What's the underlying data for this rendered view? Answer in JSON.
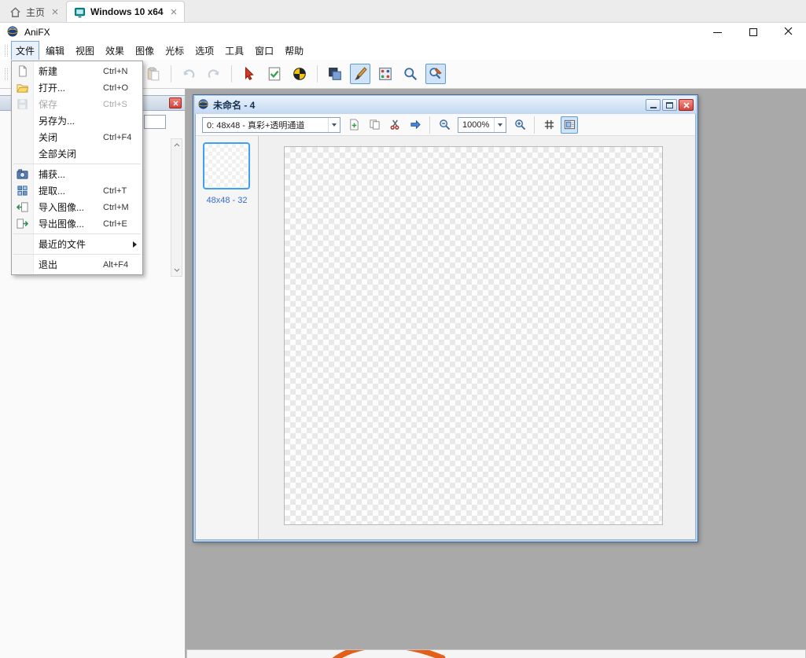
{
  "browser_tabs": {
    "tabs": [
      {
        "label": "主页",
        "icon": "home-icon",
        "active": false
      },
      {
        "label": "Windows 10 x64",
        "icon": "vm-icon",
        "active": true
      }
    ]
  },
  "window": {
    "title": "AniFX",
    "logo_icon": "app-logo-icon",
    "controls": [
      "minimize-icon",
      "maximize-icon",
      "close-icon"
    ]
  },
  "menubar": {
    "items": [
      {
        "label": "文件",
        "active": true
      },
      {
        "label": "编辑"
      },
      {
        "label": "视图"
      },
      {
        "label": "效果"
      },
      {
        "label": "图像"
      },
      {
        "label": "光标"
      },
      {
        "label": "选项"
      },
      {
        "label": "工具"
      },
      {
        "label": "窗口"
      },
      {
        "label": "帮助"
      }
    ]
  },
  "file_menu": {
    "items": [
      {
        "label": "新建",
        "shortcut": "Ctrl+N",
        "icon": "new-document-icon"
      },
      {
        "label": "打开...",
        "shortcut": "Ctrl+O",
        "icon": "open-folder-icon"
      },
      {
        "label": "保存",
        "shortcut": "Ctrl+S",
        "icon": "save-icon",
        "disabled": true
      },
      {
        "label": "另存为..."
      },
      {
        "label": "关闭",
        "shortcut": "Ctrl+F4"
      },
      {
        "label": "全部关闭"
      },
      {
        "separator": true
      },
      {
        "label": "捕获...",
        "icon": "capture-icon"
      },
      {
        "label": "提取...",
        "shortcut": "Ctrl+T",
        "icon": "extract-icon"
      },
      {
        "label": "导入图像...",
        "shortcut": "Ctrl+M",
        "icon": "import-image-icon"
      },
      {
        "label": "导出图像...",
        "shortcut": "Ctrl+E",
        "icon": "export-image-icon"
      },
      {
        "separator": true
      },
      {
        "label": "最近的文件",
        "submenu": true
      },
      {
        "separator": true
      },
      {
        "label": "退出",
        "shortcut": "Alt+F4"
      }
    ]
  },
  "toolbar": {
    "icons": [
      {
        "name": "paste-icon",
        "disabled": true
      },
      {
        "separator": true
      },
      {
        "name": "undo-icon",
        "disabled": true
      },
      {
        "name": "redo-icon",
        "disabled": true
      },
      {
        "separator": true
      },
      {
        "name": "test-cursor-icon"
      },
      {
        "name": "checklist-icon"
      },
      {
        "name": "color-wheel-icon"
      },
      {
        "separator": true
      },
      {
        "name": "transparency-icon"
      },
      {
        "name": "paintbrush-icon",
        "active": true
      },
      {
        "name": "palette-dots-icon"
      },
      {
        "name": "magnifier-icon"
      },
      {
        "name": "zoom-edit-icon",
        "active": true
      }
    ]
  },
  "left_panel": {
    "close_icon": "close-icon",
    "scrollbar": [
      "scroll-up-icon",
      "scroll-down-icon"
    ]
  },
  "document_window": {
    "title": "未命名 - 4",
    "icon": "document-icon",
    "controls": [
      "minimize-icon",
      "maximize-icon",
      "close-icon"
    ],
    "frame_select": {
      "value": "0: 48x48 - 真彩+透明通道"
    },
    "zoom_select": {
      "value": "1000%"
    },
    "icons_left": [
      {
        "name": "add-frame-icon"
      },
      {
        "name": "copy-frame-icon"
      },
      {
        "name": "cut-icon"
      },
      {
        "name": "export-frame-icon"
      },
      {
        "separator": true
      },
      {
        "name": "zoom-out-icon"
      }
    ],
    "icons_right": [
      {
        "name": "zoom-in-icon"
      },
      {
        "separator": true
      },
      {
        "name": "grid-icon"
      },
      {
        "name": "preview-icon",
        "active": true
      }
    ],
    "thumbnail": {
      "label": "48x48 - 32",
      "selected": true
    }
  },
  "colors": {
    "mdi_background": "#a9a9a9",
    "selection_blue": "#3fa0f5",
    "close_button_red": "#d9443a",
    "thumbnail_label_blue": "#3a6cd0",
    "accent_orange": "#e45f17"
  }
}
